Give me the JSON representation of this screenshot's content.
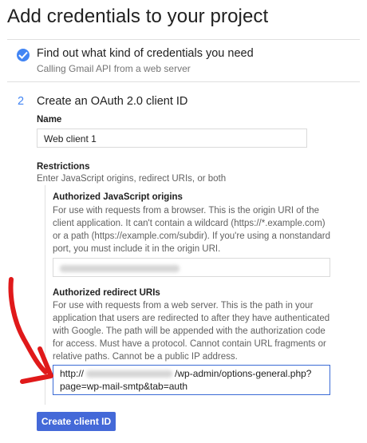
{
  "page_title": "Add credentials to your project",
  "step1": {
    "title": "Find out what kind of credentials you need",
    "subtitle": "Calling Gmail API from a web server",
    "status_icon": "check-circle-icon"
  },
  "step2": {
    "number": "2",
    "title": "Create an OAuth 2.0 client ID",
    "name_label": "Name",
    "name_value": "Web client 1",
    "restrictions_label": "Restrictions",
    "restrictions_help": "Enter JavaScript origins, redirect URIs, or both",
    "js_origins": {
      "label": "Authorized JavaScript origins",
      "help": "For use with requests from a browser. This is the origin URI of the client application. It can't contain a wildcard (https://*.example.com) or a path (https://example.com/subdir). If you're using a nonstandard port, you must include it in the origin URI."
    },
    "redirect_uris": {
      "label": "Authorized redirect URIs",
      "help": "For use with requests from a web server. This is the path in your application that users are redirected to after they have authenticated with Google. The path will be appended with the authorization code for access. Must have a protocol. Cannot contain URL fragments or relative paths. Cannot be a public IP address.",
      "value_prefix": "http://",
      "value_suffix": "/wp-admin/options-general.php?page=wp-mail-smtp&tab=auth"
    },
    "create_button": "Create client ID"
  },
  "colors": {
    "accent": "#4285f4",
    "button": "#4469d8",
    "annotation_arrow": "#e0191a"
  }
}
